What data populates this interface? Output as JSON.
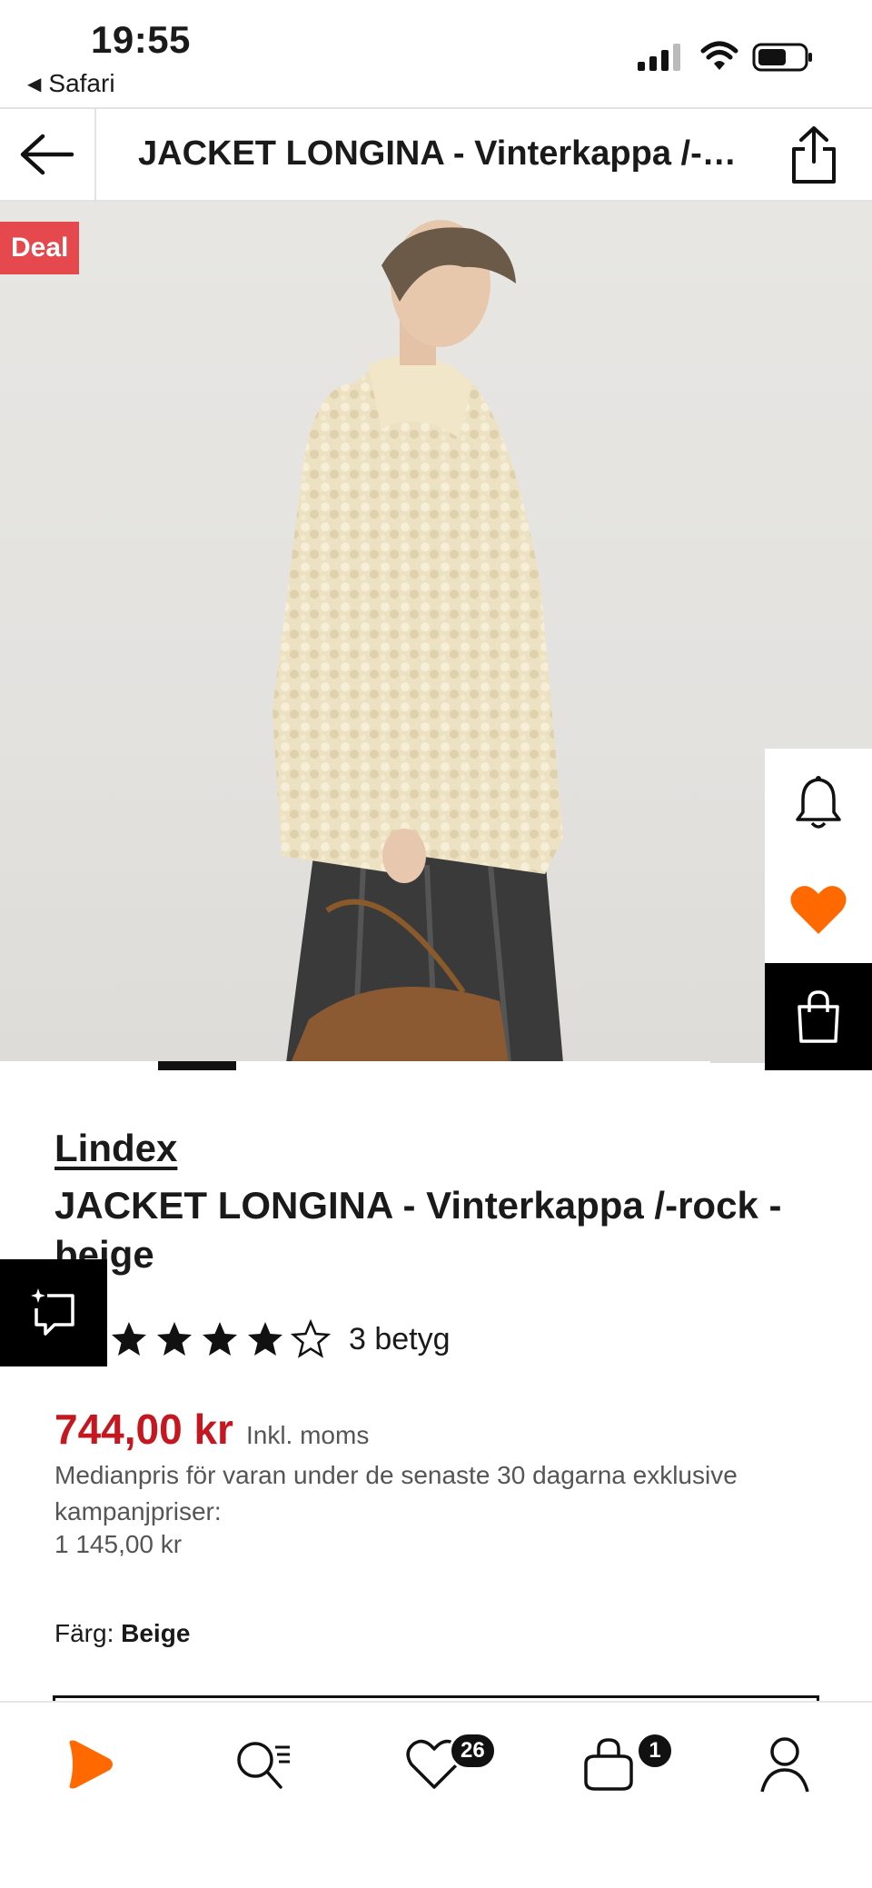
{
  "status_bar": {
    "time": "19:55",
    "back_app": "Safari",
    "icons": [
      "signal-icon",
      "wifi-icon",
      "battery-icon"
    ]
  },
  "nav": {
    "title": "JACKET LONGINA - Vinterkappa /-rock - beige",
    "icons": [
      "back-arrow-icon",
      "share-icon"
    ]
  },
  "image": {
    "deal_badge": "Deal",
    "side_actions": [
      "bell-icon",
      "heart-icon",
      "bag-icon"
    ],
    "carousel_active_index": 1,
    "carousel_count": 9
  },
  "product": {
    "brand": "Lindex",
    "name": "JACKET LONGINA - Vinterkappa /-rock - beige",
    "rating_stars": 4,
    "rating_max": 5,
    "rating_count": "3 betyg",
    "price": "744,00 kr",
    "tax_note": "Inkl. moms",
    "median_text": "Medianpris för varan under de senaste 30 dagarna exklusive kampanjpriser:",
    "median_price": "1 145,00 kr",
    "color_label": "Färg:",
    "color_value": "Beige"
  },
  "tab_bar": {
    "items": [
      "home-icon",
      "search-icon",
      "wishlist-icon",
      "cart-icon",
      "profile-icon"
    ],
    "wishlist_count": "26",
    "cart_count": "1"
  },
  "colors": {
    "accent": "#ff6900",
    "price": "#c4171f",
    "deal": "#e5484d"
  }
}
